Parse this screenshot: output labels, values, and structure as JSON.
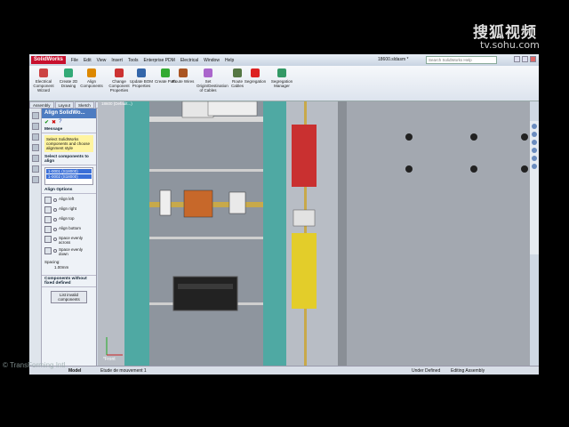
{
  "watermark": {
    "brand": "搜狐视频",
    "url": "tv.sohu.com"
  },
  "copyright": "© TransForming Intl",
  "titlebar": {
    "app_logo": "SolidWorks",
    "menus": [
      "File",
      "Edit",
      "View",
      "Insert",
      "Tools",
      "Enterprise PDM",
      "Electrical",
      "Window",
      "Help"
    ],
    "document_title": "18600.sldasm *",
    "search_placeholder": "Search SolidWorks Help"
  },
  "ribbon": {
    "buttons": [
      {
        "label": "Electrical Component Wizard",
        "icon": "component-wizard-icon",
        "color": "#c44"
      },
      {
        "label": "Create 2D Drawing",
        "icon": "drawing-icon",
        "color": "#3a7"
      },
      {
        "label": "Align Components",
        "icon": "align-icon",
        "color": "#d80"
      },
      {
        "label": "Change Component Properties",
        "icon": "change-icon",
        "color": "#c33"
      },
      {
        "label": "Update BOM Properties",
        "icon": "bom-icon",
        "color": "#36a"
      },
      {
        "label": "Create Path",
        "icon": "path-icon",
        "color": "#3a3"
      },
      {
        "label": "Route Wires",
        "icon": "route-wires-icon",
        "color": "#a52"
      },
      {
        "label": "Set Origin/Destination of Cables",
        "icon": "origin-icon",
        "color": "#a6c"
      },
      {
        "label": "Route Cables",
        "icon": "route-cables-icon",
        "color": "#574"
      },
      {
        "label": "Segregation",
        "icon": "segregation-icon",
        "color": "#d22"
      },
      {
        "label": "Segregation Manager",
        "icon": "segregation-manager-icon",
        "color": "#396"
      }
    ]
  },
  "tabs": [
    "Assembly",
    "Layout",
    "Sketch",
    "Evaluate",
    "Office Products",
    "elecworks"
  ],
  "active_tab": "elecworks",
  "property_manager": {
    "title": "Align SolidWo...",
    "message_header": "Message",
    "message": "Select SolidWorks components and choose alignment style",
    "select_header": "Select components to align",
    "selected": [
      "1-0001 (S18000)",
      "1-0002 (S18000)"
    ],
    "options_header": "Align Options",
    "options": [
      "Align left",
      "Align right",
      "Align top",
      "Align bottom",
      "Space evenly across",
      "Space evenly down"
    ],
    "spacing_label": "Spacing:",
    "spacing_value": "1.00mm",
    "without_fixed_header": "Components without fixed defined",
    "list_button": "List invalid components"
  },
  "feature_tree": [
    "18600 (Default...)"
  ],
  "statusbar": {
    "tab_model": "Model",
    "tab_motion": "Etude de mouvement 1",
    "status": "Under Defined",
    "mode": "Editing Assembly"
  },
  "viewport": {
    "triad_label": "*Front"
  }
}
